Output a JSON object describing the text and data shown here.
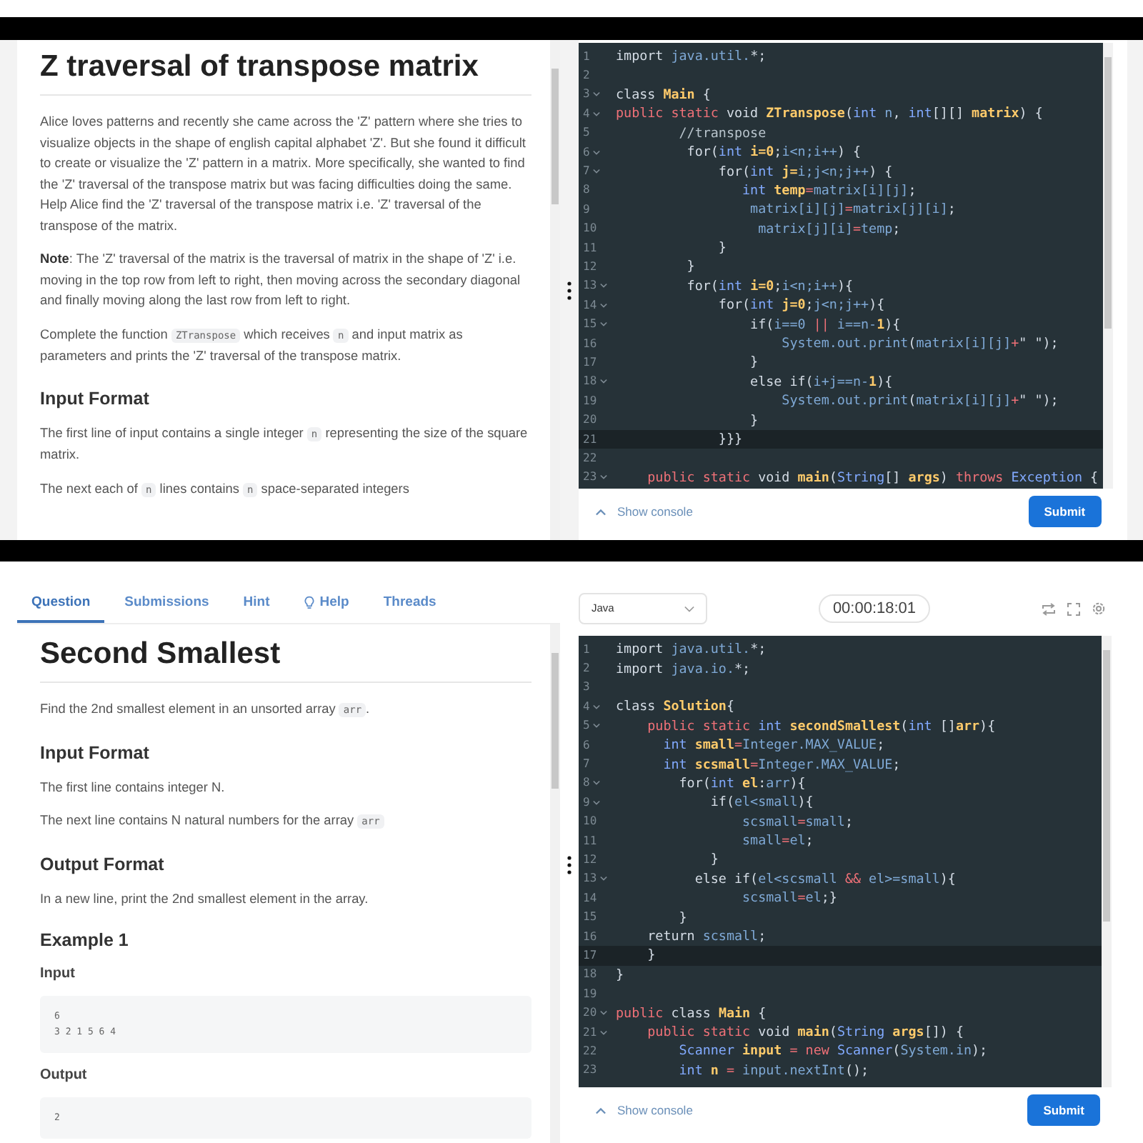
{
  "screens": [
    {
      "problem": {
        "title": "Z traversal of transpose matrix",
        "blocks": [
          {
            "kind": "paragraph",
            "parts": [
              {
                "kind": "text",
                "text": "Alice loves patterns and recently she came across the 'Z' pattern where she tries to visualize objects in the shape of english capital alphabet 'Z'. But she found it difficult to create or visualize the 'Z' pattern in a matrix. More specifically, she wanted to find the 'Z' traversal of the transpose matrix but was facing difficulties doing the same. Help Alice find the 'Z' traversal of the transpose matrix i.e. 'Z' traversal of the transpose of the matrix."
              }
            ]
          },
          {
            "kind": "paragraph",
            "parts": [
              {
                "kind": "bold",
                "text": "Note"
              },
              {
                "kind": "text",
                "text": ": The 'Z' traversal of the matrix is the traversal of matrix in the shape of 'Z' i.e. moving in the top row from left to right, then moving across the secondary diagonal and finally moving along the last row from left to right."
              }
            ]
          },
          {
            "kind": "paragraph",
            "parts": [
              {
                "kind": "text",
                "text": "Complete the function "
              },
              {
                "kind": "code",
                "text": "ZTranspose"
              },
              {
                "kind": "text",
                "text": " which receives "
              },
              {
                "kind": "code",
                "text": "n"
              },
              {
                "kind": "text",
                "text": " and input matrix as parameters and prints the 'Z' traversal of the transpose matrix."
              }
            ]
          },
          {
            "kind": "heading",
            "text": "Input Format"
          },
          {
            "kind": "paragraph",
            "parts": [
              {
                "kind": "text",
                "text": "The first line of input contains a single integer "
              },
              {
                "kind": "code",
                "text": "n"
              },
              {
                "kind": "text",
                "text": " representing the size of the square matrix."
              }
            ]
          },
          {
            "kind": "paragraph",
            "parts": [
              {
                "kind": "text",
                "text": "The next each of "
              },
              {
                "kind": "code",
                "text": "n"
              },
              {
                "kind": "text",
                "text": " lines contains "
              },
              {
                "kind": "code",
                "text": "n"
              },
              {
                "kind": "text",
                "text": " space-separated integers"
              }
            ]
          }
        ]
      },
      "editor": {
        "lines": [
          {
            "number": "1",
            "foldable": false,
            "active": false,
            "segments": [
              {
                "kind": "plain",
                "text": "import "
              },
              {
                "kind": "var",
                "text": "java.util."
              },
              {
                "kind": "plain",
                "text": "*;"
              }
            ]
          },
          {
            "number": "2",
            "foldable": false,
            "active": false
          },
          {
            "number": "3",
            "foldable": true,
            "active": false,
            "segments": [
              {
                "kind": "plain",
                "text": "class "
              },
              {
                "kind": "name",
                "text": "Main"
              },
              {
                "kind": "plain",
                "text": " {"
              }
            ]
          },
          {
            "number": "4",
            "foldable": true,
            "active": false,
            "segments": [
              {
                "kind": "kw",
                "text": "public static "
              },
              {
                "kind": "plain",
                "text": "void "
              },
              {
                "kind": "name",
                "text": "ZTranspose"
              },
              {
                "kind": "plain",
                "text": "("
              },
              {
                "kind": "type",
                "text": "int "
              },
              {
                "kind": "var",
                "text": "n"
              },
              {
                "kind": "plain",
                "text": ", "
              },
              {
                "kind": "type",
                "text": "int"
              },
              {
                "kind": "plain",
                "text": "[][] "
              },
              {
                "kind": "name",
                "text": "matrix"
              },
              {
                "kind": "plain",
                "text": ") {"
              }
            ]
          },
          {
            "number": "5",
            "foldable": false,
            "active": false,
            "segments": [
              {
                "kind": "comment",
                "text": "        //transpose"
              }
            ]
          },
          {
            "number": "6",
            "foldable": true,
            "active": false,
            "segments": [
              {
                "kind": "plain",
                "text": "         for("
              },
              {
                "kind": "type",
                "text": "int "
              },
              {
                "kind": "name",
                "text": "i=0"
              },
              {
                "kind": "plain",
                "text": ";"
              },
              {
                "kind": "var",
                "text": "i<n;i++"
              },
              {
                "kind": "plain",
                "text": ") {"
              }
            ]
          },
          {
            "number": "7",
            "foldable": true,
            "active": false,
            "segments": [
              {
                "kind": "plain",
                "text": "             for("
              },
              {
                "kind": "type",
                "text": "int "
              },
              {
                "kind": "name",
                "text": "j="
              },
              {
                "kind": "var",
                "text": "i;j<n;j++"
              },
              {
                "kind": "plain",
                "text": ") {"
              }
            ]
          },
          {
            "number": "8",
            "foldable": false,
            "active": false,
            "segments": [
              {
                "kind": "type",
                "text": "                int "
              },
              {
                "kind": "name",
                "text": "temp"
              },
              {
                "kind": "op",
                "text": "="
              },
              {
                "kind": "var",
                "text": "matrix[i][j]"
              },
              {
                "kind": "plain",
                "text": ";"
              }
            ]
          },
          {
            "number": "9",
            "foldable": false,
            "active": false,
            "segments": [
              {
                "kind": "var",
                "text": "                 matrix[i][j]"
              },
              {
                "kind": "op",
                "text": "="
              },
              {
                "kind": "var",
                "text": "matrix[j][i]"
              },
              {
                "kind": "plain",
                "text": ";"
              }
            ]
          },
          {
            "number": "10",
            "foldable": false,
            "active": false,
            "segments": [
              {
                "kind": "var",
                "text": "                  matrix[j][i]"
              },
              {
                "kind": "op",
                "text": "="
              },
              {
                "kind": "var",
                "text": "temp"
              },
              {
                "kind": "plain",
                "text": ";"
              }
            ]
          },
          {
            "number": "11",
            "foldable": false,
            "active": false,
            "segments": [
              {
                "kind": "plain",
                "text": "             }"
              }
            ]
          },
          {
            "number": "12",
            "foldable": false,
            "active": false,
            "segments": [
              {
                "kind": "plain",
                "text": "         }"
              }
            ]
          },
          {
            "number": "13",
            "foldable": true,
            "active": false,
            "segments": [
              {
                "kind": "plain",
                "text": "         for("
              },
              {
                "kind": "type",
                "text": "int "
              },
              {
                "kind": "name",
                "text": "i=0"
              },
              {
                "kind": "plain",
                "text": ";"
              },
              {
                "kind": "var",
                "text": "i<n;i++"
              },
              {
                "kind": "plain",
                "text": "){"
              }
            ]
          },
          {
            "number": "14",
            "foldable": true,
            "active": false,
            "segments": [
              {
                "kind": "plain",
                "text": "             for("
              },
              {
                "kind": "type",
                "text": "int "
              },
              {
                "kind": "name",
                "text": "j=0"
              },
              {
                "kind": "plain",
                "text": ";"
              },
              {
                "kind": "var",
                "text": "j<n;j++"
              },
              {
                "kind": "plain",
                "text": "){"
              }
            ]
          },
          {
            "number": "15",
            "foldable": true,
            "active": false,
            "segments": [
              {
                "kind": "plain",
                "text": "                 if("
              },
              {
                "kind": "var",
                "text": "i==0 "
              },
              {
                "kind": "op",
                "text": "|| "
              },
              {
                "kind": "var",
                "text": "i==n-"
              },
              {
                "kind": "name",
                "text": "1"
              },
              {
                "kind": "plain",
                "text": "){"
              }
            ]
          },
          {
            "number": "16",
            "foldable": false,
            "active": false,
            "segments": [
              {
                "kind": "var",
                "text": "                     System.out.print"
              },
              {
                "kind": "plain",
                "text": "("
              },
              {
                "kind": "var",
                "text": "matrix[i][j]"
              },
              {
                "kind": "op",
                "text": "+"
              },
              {
                "kind": "plain",
                "text": "\" \");"
              }
            ]
          },
          {
            "number": "17",
            "foldable": false,
            "active": false,
            "segments": [
              {
                "kind": "plain",
                "text": "                 }"
              }
            ]
          },
          {
            "number": "18",
            "foldable": true,
            "active": false,
            "segments": [
              {
                "kind": "plain",
                "text": "                 else if("
              },
              {
                "kind": "var",
                "text": "i+j==n-"
              },
              {
                "kind": "name",
                "text": "1"
              },
              {
                "kind": "plain",
                "text": "){"
              }
            ]
          },
          {
            "number": "19",
            "foldable": false,
            "active": false,
            "segments": [
              {
                "kind": "var",
                "text": "                     System.out.print"
              },
              {
                "kind": "plain",
                "text": "("
              },
              {
                "kind": "var",
                "text": "matrix[i][j]"
              },
              {
                "kind": "op",
                "text": "+"
              },
              {
                "kind": "plain",
                "text": "\" \");"
              }
            ]
          },
          {
            "number": "20",
            "foldable": false,
            "active": false,
            "segments": [
              {
                "kind": "plain",
                "text": "                 }"
              }
            ]
          },
          {
            "number": "21",
            "foldable": false,
            "active": true,
            "segments": [
              {
                "kind": "plain",
                "text": "             }}}"
              }
            ]
          },
          {
            "number": "22",
            "foldable": false,
            "active": false
          },
          {
            "number": "23",
            "foldable": true,
            "active": false,
            "segments": [
              {
                "kind": "kw",
                "text": "    public static "
              },
              {
                "kind": "plain",
                "text": "void "
              },
              {
                "kind": "name",
                "text": "main"
              },
              {
                "kind": "plain",
                "text": "("
              },
              {
                "kind": "type",
                "text": "String"
              },
              {
                "kind": "plain",
                "text": "[] "
              },
              {
                "kind": "name",
                "text": "args"
              },
              {
                "kind": "plain",
                "text": ") "
              },
              {
                "kind": "kw",
                "text": "throws "
              },
              {
                "kind": "type",
                "text": "Exception"
              },
              {
                "kind": "plain",
                "text": " {"
              }
            ]
          }
        ],
        "console_label": "Show console",
        "submit_label": "Submit"
      }
    },
    {
      "tabs": [
        {
          "label": "Question",
          "selected": true,
          "icon": false
        },
        {
          "label": "Submissions",
          "selected": false,
          "icon": false
        },
        {
          "label": "Hint",
          "selected": false,
          "icon": false
        },
        {
          "label": "Help",
          "selected": false,
          "icon": true
        },
        {
          "label": "Threads",
          "selected": false,
          "icon": false
        }
      ],
      "problem": {
        "title": "Second Smallest",
        "blocks": [
          {
            "kind": "paragraph",
            "parts": [
              {
                "kind": "text",
                "text": "Find the 2nd smallest element in an unsorted array "
              },
              {
                "kind": "code",
                "text": "arr"
              },
              {
                "kind": "text",
                "text": "."
              }
            ]
          },
          {
            "kind": "heading",
            "text": "Input Format"
          },
          {
            "kind": "paragraph",
            "parts": [
              {
                "kind": "text",
                "text": "The first line contains integer N."
              }
            ]
          },
          {
            "kind": "paragraph",
            "parts": [
              {
                "kind": "text",
                "text": "The next line contains N natural numbers for the array "
              },
              {
                "kind": "code",
                "text": "arr"
              }
            ]
          },
          {
            "kind": "heading",
            "text": "Output Format"
          },
          {
            "kind": "paragraph",
            "parts": [
              {
                "kind": "text",
                "text": "In a new line, print the 2nd smallest element in the array."
              }
            ]
          },
          {
            "kind": "heading",
            "text": "Example 1"
          },
          {
            "kind": "subheading",
            "text": "Input"
          },
          {
            "kind": "sample",
            "text": "6\n3 2 1 5 6 4"
          },
          {
            "kind": "subheading",
            "text": "Output"
          },
          {
            "kind": "sample",
            "text": "2"
          }
        ]
      },
      "toolbar": {
        "language": "Java",
        "timer": "00:00:18:01"
      },
      "editor": {
        "lines": [
          {
            "number": "1",
            "foldable": false,
            "active": false,
            "segments": [
              {
                "kind": "plain",
                "text": "import "
              },
              {
                "kind": "var",
                "text": "java.util."
              },
              {
                "kind": "plain",
                "text": "*;"
              }
            ]
          },
          {
            "number": "2",
            "foldable": false,
            "active": false,
            "segments": [
              {
                "kind": "plain",
                "text": "import "
              },
              {
                "kind": "var",
                "text": "java.io."
              },
              {
                "kind": "plain",
                "text": "*;"
              }
            ]
          },
          {
            "number": "3",
            "foldable": false,
            "active": false
          },
          {
            "number": "4",
            "foldable": true,
            "active": false,
            "segments": [
              {
                "kind": "plain",
                "text": "class "
              },
              {
                "kind": "name",
                "text": "Solution"
              },
              {
                "kind": "plain",
                "text": "{"
              }
            ]
          },
          {
            "number": "5",
            "foldable": true,
            "active": false,
            "segments": [
              {
                "kind": "kw",
                "text": "    public static "
              },
              {
                "kind": "type",
                "text": "int "
              },
              {
                "kind": "name",
                "text": "secondSmallest"
              },
              {
                "kind": "plain",
                "text": "("
              },
              {
                "kind": "type",
                "text": "int "
              },
              {
                "kind": "plain",
                "text": "[]"
              },
              {
                "kind": "name",
                "text": "arr"
              },
              {
                "kind": "plain",
                "text": "){"
              }
            ]
          },
          {
            "number": "6",
            "foldable": false,
            "active": false,
            "segments": [
              {
                "kind": "type",
                "text": "      int "
              },
              {
                "kind": "name",
                "text": "small"
              },
              {
                "kind": "op",
                "text": "="
              },
              {
                "kind": "var",
                "text": "Integer.MAX_VALUE"
              },
              {
                "kind": "plain",
                "text": ";"
              }
            ]
          },
          {
            "number": "7",
            "foldable": false,
            "active": false,
            "segments": [
              {
                "kind": "type",
                "text": "      int "
              },
              {
                "kind": "name",
                "text": "scsmall"
              },
              {
                "kind": "op",
                "text": "="
              },
              {
                "kind": "var",
                "text": "Integer.MAX_VALUE"
              },
              {
                "kind": "plain",
                "text": ";"
              }
            ]
          },
          {
            "number": "8",
            "foldable": true,
            "active": false,
            "segments": [
              {
                "kind": "plain",
                "text": "        for("
              },
              {
                "kind": "type",
                "text": "int "
              },
              {
                "kind": "name",
                "text": "el"
              },
              {
                "kind": "plain",
                "text": ":"
              },
              {
                "kind": "var",
                "text": "arr"
              },
              {
                "kind": "plain",
                "text": "){"
              }
            ]
          },
          {
            "number": "9",
            "foldable": true,
            "active": false,
            "segments": [
              {
                "kind": "plain",
                "text": "            if("
              },
              {
                "kind": "var",
                "text": "el<small"
              },
              {
                "kind": "plain",
                "text": "){"
              }
            ]
          },
          {
            "number": "10",
            "foldable": false,
            "active": false,
            "segments": [
              {
                "kind": "var",
                "text": "                scsmall"
              },
              {
                "kind": "op",
                "text": "="
              },
              {
                "kind": "var",
                "text": "small"
              },
              {
                "kind": "plain",
                "text": ";"
              }
            ]
          },
          {
            "number": "11",
            "foldable": false,
            "active": false,
            "segments": [
              {
                "kind": "var",
                "text": "                small"
              },
              {
                "kind": "op",
                "text": "="
              },
              {
                "kind": "var",
                "text": "el"
              },
              {
                "kind": "plain",
                "text": ";"
              }
            ]
          },
          {
            "number": "12",
            "foldable": false,
            "active": false,
            "segments": [
              {
                "kind": "plain",
                "text": "            }"
              }
            ]
          },
          {
            "number": "13",
            "foldable": true,
            "active": false,
            "segments": [
              {
                "kind": "plain",
                "text": "          else if("
              },
              {
                "kind": "var",
                "text": "el<scsmall "
              },
              {
                "kind": "op",
                "text": "&& "
              },
              {
                "kind": "var",
                "text": "el>=small"
              },
              {
                "kind": "plain",
                "text": "){"
              }
            ]
          },
          {
            "number": "14",
            "foldable": false,
            "active": false,
            "segments": [
              {
                "kind": "var",
                "text": "                scsmall"
              },
              {
                "kind": "op",
                "text": "="
              },
              {
                "kind": "var",
                "text": "el"
              },
              {
                "kind": "plain",
                "text": ";}"
              }
            ]
          },
          {
            "number": "15",
            "foldable": false,
            "active": false,
            "segments": [
              {
                "kind": "plain",
                "text": "        }"
              }
            ]
          },
          {
            "number": "16",
            "foldable": false,
            "active": false,
            "segments": [
              {
                "kind": "plain",
                "text": "    return "
              },
              {
                "kind": "var",
                "text": "scsmall"
              },
              {
                "kind": "plain",
                "text": ";"
              }
            ]
          },
          {
            "number": "17",
            "foldable": false,
            "active": true,
            "segments": [
              {
                "kind": "plain",
                "text": "    }"
              }
            ]
          },
          {
            "number": "18",
            "foldable": false,
            "active": false,
            "segments": [
              {
                "kind": "plain",
                "text": "}"
              }
            ]
          },
          {
            "number": "19",
            "foldable": false,
            "active": false
          },
          {
            "number": "20",
            "foldable": true,
            "active": false,
            "segments": [
              {
                "kind": "kw",
                "text": "public "
              },
              {
                "kind": "plain",
                "text": "class "
              },
              {
                "kind": "name",
                "text": "Main"
              },
              {
                "kind": "plain",
                "text": " {"
              }
            ]
          },
          {
            "number": "21",
            "foldable": true,
            "active": false,
            "segments": [
              {
                "kind": "kw",
                "text": "    public static "
              },
              {
                "kind": "plain",
                "text": "void "
              },
              {
                "kind": "name",
                "text": "main"
              },
              {
                "kind": "plain",
                "text": "("
              },
              {
                "kind": "type",
                "text": "String "
              },
              {
                "kind": "name",
                "text": "args"
              },
              {
                "kind": "plain",
                "text": "[]) {"
              }
            ]
          },
          {
            "number": "22",
            "foldable": false,
            "active": false,
            "segments": [
              {
                "kind": "type",
                "text": "        Scanner "
              },
              {
                "kind": "name",
                "text": "input"
              },
              {
                "kind": "op",
                "text": " = "
              },
              {
                "kind": "kw",
                "text": "new "
              },
              {
                "kind": "type",
                "text": "Scanner"
              },
              {
                "kind": "plain",
                "text": "("
              },
              {
                "kind": "var",
                "text": "System.in"
              },
              {
                "kind": "plain",
                "text": ");"
              }
            ]
          },
          {
            "number": "23",
            "foldable": false,
            "active": false,
            "segments": [
              {
                "kind": "type",
                "text": "        int "
              },
              {
                "kind": "name",
                "text": "n"
              },
              {
                "kind": "op",
                "text": " = "
              },
              {
                "kind": "var",
                "text": "input.nextInt"
              },
              {
                "kind": "plain",
                "text": "();"
              }
            ]
          }
        ],
        "console_label": "Show console",
        "submit_label": "Submit"
      }
    }
  ]
}
